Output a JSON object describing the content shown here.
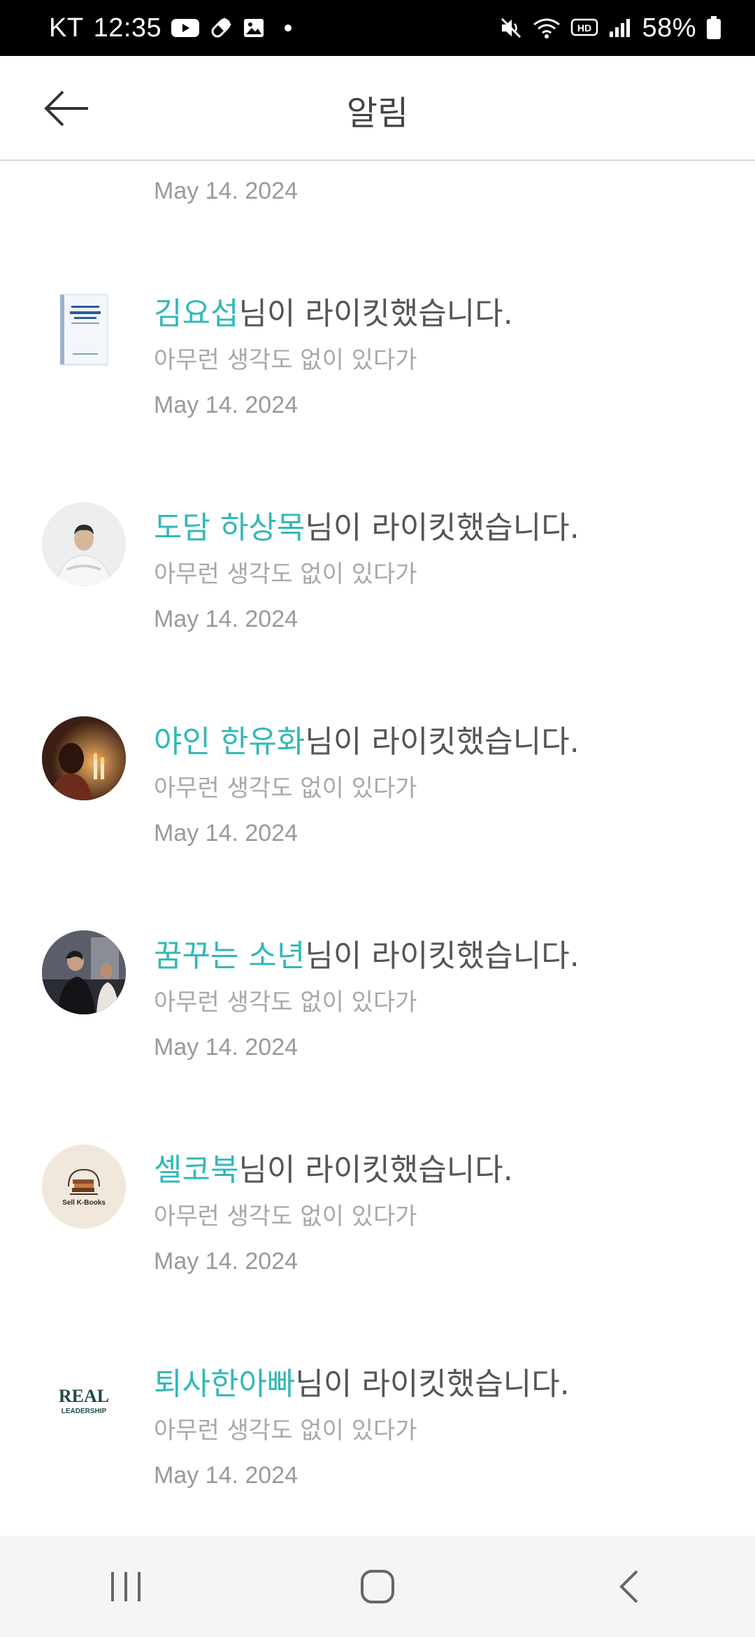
{
  "status_bar": {
    "carrier": "KT",
    "time": "12:35",
    "battery": "58%",
    "left_icons": [
      "youtube-icon",
      "pill-icon",
      "gallery-icon",
      "dot-icon"
    ],
    "right_icons": [
      "mute-icon",
      "wifi-icon",
      "hd-icon",
      "signal-icon",
      "battery-icon"
    ]
  },
  "header": {
    "title": "알림",
    "back_icon": "arrow-left-icon"
  },
  "list": {
    "partial_date": "May 14. 2024",
    "suffix": "님이 라이킷했습니다.",
    "items": [
      {
        "user": "김요섭",
        "suffix": "님이 라이킷했습니다.",
        "article": "아무런 생각도 없이 있다가",
        "date": "May 14. 2024"
      },
      {
        "user": "도담 하상목",
        "suffix": "님이 라이킷했습니다.",
        "article": "아무런 생각도 없이 있다가",
        "date": "May 14. 2024"
      },
      {
        "user": "야인 한유화",
        "suffix": "님이 라이킷했습니다.",
        "article": "아무런 생각도 없이 있다가",
        "date": "May 14. 2024"
      },
      {
        "user": "꿈꾸는 소년",
        "suffix": "님이 라이킷했습니다.",
        "article": "아무런 생각도 없이 있다가",
        "date": "May 14. 2024"
      },
      {
        "user": "셀코북",
        "suffix": "님이 라이킷했습니다.",
        "article": "아무런 생각도 없이 있다가",
        "date": "May 14. 2024",
        "avatar_text": "Sell K-Books"
      },
      {
        "user": "퇴사한아빠",
        "suffix": "님이 라이킷했습니다.",
        "article": "아무런 생각도 없이 있다가",
        "date": "May 14. 2024",
        "avatar_text": [
          "REAL",
          "LEADERSHIP"
        ]
      }
    ]
  },
  "nav_bar": {
    "icons": [
      "recent-apps-icon",
      "home-icon",
      "back-icon"
    ]
  },
  "colors": {
    "accent": "#33b8b8",
    "text": "#555555",
    "muted": "#a8a8a8"
  }
}
